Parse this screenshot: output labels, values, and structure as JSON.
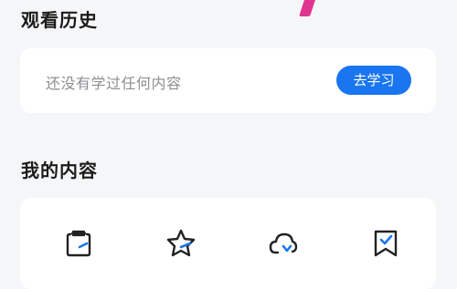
{
  "history": {
    "title": "观看历史",
    "empty_text": "还没有学过任何内容",
    "button_label": "去学习"
  },
  "my_content": {
    "title": "我的内容",
    "items": [
      {
        "icon": "clipboard-icon",
        "label": ""
      },
      {
        "icon": "star-icon",
        "label": ""
      },
      {
        "icon": "cloud-download-icon",
        "label": ""
      },
      {
        "icon": "bookmark-check-icon",
        "label": ""
      }
    ]
  },
  "colors": {
    "accent": "#1975f0",
    "background": "#f5f6f8",
    "card": "#ffffff",
    "pink_accent": "#e0358f"
  }
}
